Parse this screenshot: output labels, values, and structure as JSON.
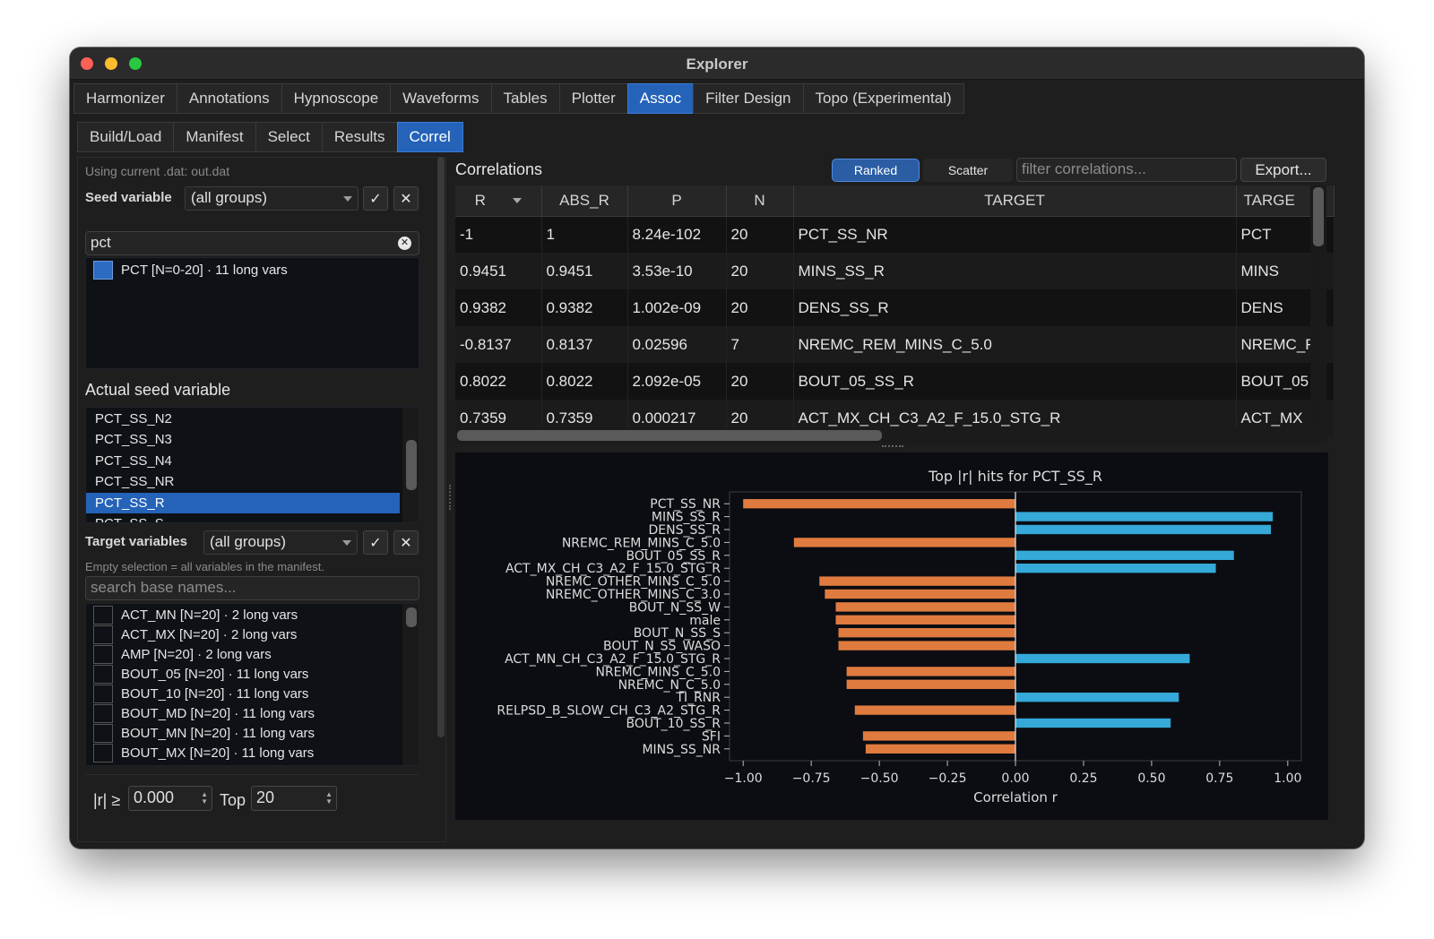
{
  "window": {
    "title": "Explorer"
  },
  "main_tabs": [
    "Harmonizer",
    "Annotations",
    "Hypnoscope",
    "Waveforms",
    "Tables",
    "Plotter",
    "Assoc",
    "Filter Design",
    "Topo (Experimental)"
  ],
  "main_active": "Assoc",
  "sub_tabs": [
    "Build/Load",
    "Manifest",
    "Select",
    "Results",
    "Correl"
  ],
  "sub_active": "Correl",
  "left": {
    "using_text": "Using current .dat: out.dat",
    "seed_label": "Seed variable",
    "seed_combo": "(all groups)",
    "confirm_glyph": "✓",
    "clear_glyph": "✕",
    "seed_search_value": "pct",
    "seed_groups": [
      {
        "name": "PCT",
        "n": "[N=0-20]",
        "desc": "· 11 long vars"
      }
    ],
    "actual_seed_label": "Actual seed variable",
    "seed_vars": [
      "PCT_SS_N2",
      "PCT_SS_N3",
      "PCT_SS_N4",
      "PCT_SS_NR",
      "PCT_SS_R",
      "PCT_SS_S"
    ],
    "seed_selected": "PCT_SS_R",
    "target_label": "Target variables",
    "target_combo": "(all groups)",
    "empty_note": "Empty selection = all variables in the manifest.",
    "target_search_placeholder": "search base names...",
    "target_groups": [
      {
        "name": "ACT_MN",
        "n": "[N=20]",
        "desc": "· 2 long vars"
      },
      {
        "name": "ACT_MX",
        "n": "[N=20]",
        "desc": "· 2 long vars"
      },
      {
        "name": "AMP",
        "n": "[N=20]",
        "desc": "· 2 long vars"
      },
      {
        "name": "BOUT_05",
        "n": "[N=20]",
        "desc": "· 11 long vars"
      },
      {
        "name": "BOUT_10",
        "n": "[N=20]",
        "desc": "· 11 long vars"
      },
      {
        "name": "BOUT_MD",
        "n": "[N=20]",
        "desc": "· 11 long vars"
      },
      {
        "name": "BOUT_MN",
        "n": "[N=20]",
        "desc": "· 11 long vars"
      },
      {
        "name": "BOUT_MX",
        "n": "[N=20]",
        "desc": "· 11 long vars"
      }
    ],
    "r_threshold_label": "|r| ≥",
    "r_threshold_value": "0.000",
    "top_label": "Top",
    "top_value": "20"
  },
  "right": {
    "title": "Correlations",
    "mode_ranked": "Ranked",
    "mode_scatter": "Scatter",
    "filter_placeholder": "filter correlations...",
    "export_label": "Export...",
    "columns": [
      "R",
      "ABS_R",
      "P",
      "N",
      "TARGET",
      "TARGE"
    ],
    "rows": [
      [
        "-1",
        "1",
        "8.24e-102",
        "20",
        "PCT_SS_NR",
        "PCT"
      ],
      [
        "0.9451",
        "0.9451",
        "3.53e-10",
        "20",
        "MINS_SS_R",
        "MINS"
      ],
      [
        "0.9382",
        "0.9382",
        "1.002e-09",
        "20",
        "DENS_SS_R",
        "DENS"
      ],
      [
        "-0.8137",
        "0.8137",
        "0.02596",
        "7",
        "NREMC_REM_MINS_C_5.0",
        "NREMC_F"
      ],
      [
        "0.8022",
        "0.8022",
        "2.092e-05",
        "20",
        "BOUT_05_SS_R",
        "BOUT_05"
      ],
      [
        "0.7359",
        "0.7359",
        "0.000217",
        "20",
        "ACT_MX_CH_C3_A2_F_15.0_STG_R",
        "ACT_MX"
      ]
    ]
  },
  "chart_data": {
    "type": "bar",
    "orientation": "horizontal",
    "title": "Top |r| hits for PCT_SS_R",
    "xlabel": "Correlation r",
    "ylabel": "",
    "xlim": [
      -1.05,
      1.05
    ],
    "xticks": [
      -1.0,
      -0.75,
      -0.5,
      -0.25,
      0.0,
      0.25,
      0.5,
      0.75,
      1.0
    ],
    "xtick_labels": [
      "−1.00",
      "−0.75",
      "−0.50",
      "−0.25",
      "0.00",
      "0.25",
      "0.50",
      "0.75",
      "1.00"
    ],
    "colors": {
      "negative": "#e07b3f",
      "positive": "#35a9d8"
    },
    "categories": [
      "PCT_SS_NR",
      "MINS_SS_R",
      "DENS_SS_R",
      "NREMC_REM_MINS_C_5.0",
      "BOUT_05_SS_R",
      "ACT_MX_CH_C3_A2_F_15.0_STG_R",
      "NREMC_OTHER_MINS_C_5.0",
      "NREMC_OTHER_MINS_C_3.0",
      "BOUT_N_SS_W",
      "male",
      "BOUT_N_SS_S",
      "BOUT_N_SS_WASO",
      "ACT_MN_CH_C3_A2_F_15.0_STG_R",
      "NREMC_MINS_C_5.0",
      "NREMC_N_C_5.0",
      "TI_RNR",
      "RELPSD_B_SLOW_CH_C3_A2_STG_R",
      "BOUT_10_SS_R",
      "SFI",
      "MINS_SS_NR"
    ],
    "values": [
      -1.0,
      0.9451,
      0.9382,
      -0.8137,
      0.8022,
      0.7359,
      -0.72,
      -0.7,
      -0.66,
      -0.66,
      -0.65,
      -0.65,
      0.64,
      -0.62,
      -0.62,
      0.6,
      -0.59,
      0.57,
      -0.56,
      -0.55
    ],
    "grid": false
  }
}
